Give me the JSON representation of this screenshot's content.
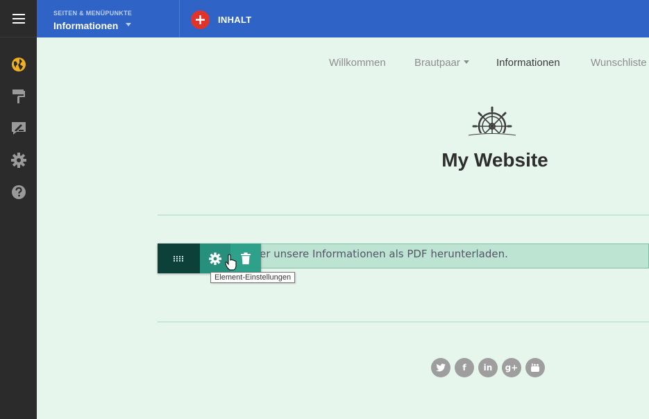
{
  "topbar": {
    "pages_caption": "SEITEN & MENÜPUNKTE",
    "current_page": "Informationen",
    "content_button": "INHALT"
  },
  "rail": {
    "menu_icon": "hamburger-icon",
    "items": [
      {
        "icon": "globe-icon",
        "color": "#f2b01e"
      },
      {
        "icon": "paint-roller-icon",
        "color": "#9a9a9a"
      },
      {
        "icon": "edit-icon",
        "color": "#9a9a9a"
      },
      {
        "icon": "gear-icon",
        "color": "#9a9a9a"
      },
      {
        "icon": "help-icon",
        "color": "#9a9a9a"
      }
    ]
  },
  "site": {
    "nav": [
      {
        "label": "Willkommen",
        "active": false
      },
      {
        "label": "Brautpaar",
        "active": false,
        "dropdown": true
      },
      {
        "label": "Informationen",
        "active": true
      },
      {
        "label": "Wunschliste",
        "active": false
      }
    ],
    "logo": "ship-wheel-logo",
    "title": "My Website",
    "text_element": "er unsere Informationen als PDF herunterladen.",
    "tooltip": "Element-Einstellungen",
    "social": [
      {
        "icon": "twitter-icon"
      },
      {
        "icon": "facebook-icon",
        "glyph": "f"
      },
      {
        "icon": "linkedin-icon",
        "glyph": "in"
      },
      {
        "icon": "google-plus-icon",
        "glyph": "g+"
      },
      {
        "icon": "youtube-icon"
      }
    ]
  },
  "colors": {
    "topbar": "#2f63c6",
    "rail": "#2b2b2b",
    "canvas": "#e7f6ec",
    "accent_red": "#e0342b",
    "toolbar_dark": "#0d4038",
    "toolbar_teal": "#27907c"
  }
}
